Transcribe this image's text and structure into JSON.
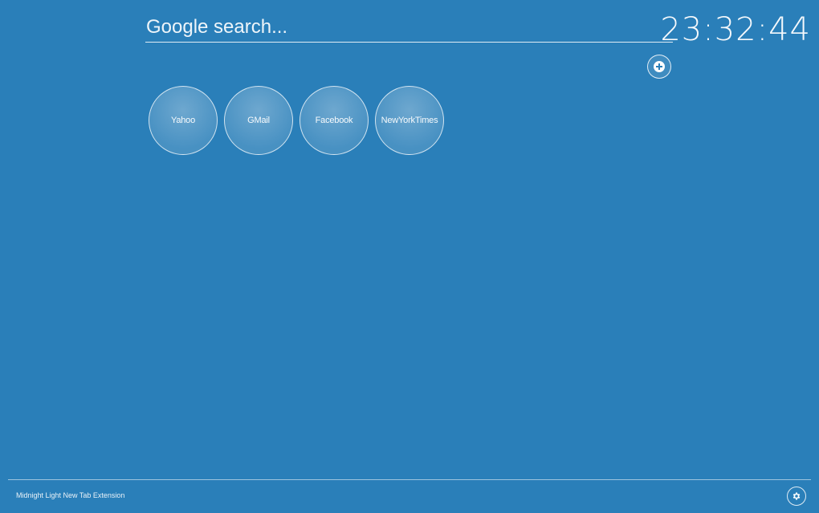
{
  "search": {
    "placeholder": "Google search...",
    "value": ""
  },
  "clock": {
    "time": "23:32:44"
  },
  "add_button": {
    "icon": "plus-icon"
  },
  "shortcuts": [
    {
      "label": "Yahoo"
    },
    {
      "label": "GMail"
    },
    {
      "label": "Facebook"
    },
    {
      "label": "NewYorkTimes"
    }
  ],
  "footer": {
    "text": "Midnight Light New Tab Extension",
    "settings_icon": "gear-icon"
  },
  "colors": {
    "background": "#2a7fb9",
    "foreground": "#ffffff"
  }
}
